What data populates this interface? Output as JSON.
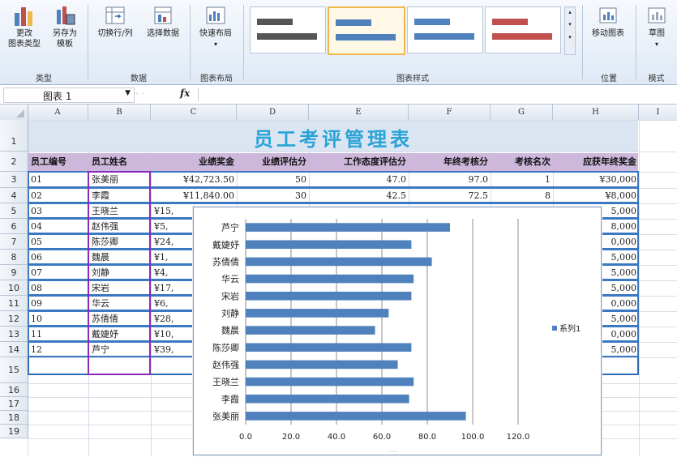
{
  "ribbon": {
    "buttons": [
      {
        "id": "change-type",
        "label1": "更改",
        "label2": "图表类型"
      },
      {
        "id": "save-template",
        "label1": "另存为",
        "label2": "模板"
      },
      {
        "id": "switch-row-col",
        "label1": "切换行/列",
        "label2": ""
      },
      {
        "id": "select-data",
        "label1": "选择数据",
        "label2": ""
      },
      {
        "id": "quick-layout",
        "label1": "快速布局",
        "label2": ""
      },
      {
        "id": "move-chart",
        "label1": "移动图表",
        "label2": ""
      },
      {
        "id": "draft",
        "label1": "草图",
        "label2": ""
      }
    ],
    "groups": {
      "type": "类型",
      "data": "数据",
      "layouts": "图表布局",
      "styles": "图表样式",
      "location": "位置",
      "mode": "模式"
    },
    "colors": {
      "style_dark": "#555555",
      "style_blue": "#4f81bd",
      "style_red": "#c0504d",
      "accent": "#f0b84a"
    }
  },
  "formula_bar": {
    "name_box": "图表 1",
    "fx": "fx"
  },
  "columns": [
    "A",
    "B",
    "C",
    "D",
    "E",
    "F",
    "G",
    "H",
    "I"
  ],
  "rows": [
    "1",
    "2",
    "3",
    "4",
    "5",
    "6",
    "7",
    "8",
    "9",
    "10",
    "11",
    "12",
    "13",
    "14",
    "15",
    "16",
    "17",
    "18",
    "19"
  ],
  "sheet": {
    "title": "员工考评管理表",
    "headers": [
      "员工编号",
      "员工姓名",
      "业绩奖金",
      "业绩评估分",
      "工作态度评估分",
      "年终考核分",
      "考核名次",
      "应获年终奖金"
    ],
    "rows": [
      {
        "id": "01",
        "name": "张美丽",
        "bonus": "¥42,723.50",
        "perf": "50",
        "att": "47.0",
        "final": "97.0",
        "rank": "1",
        "award": "¥30,000"
      },
      {
        "id": "02",
        "name": "李霞",
        "bonus": "¥11,840.00",
        "perf": "30",
        "att": "42.5",
        "final": "72.5",
        "rank": "8",
        "award": "¥8,000"
      },
      {
        "id": "03",
        "name": "王晓兰",
        "bonus": "¥15,",
        "award": "5,000"
      },
      {
        "id": "04",
        "name": "赵伟强",
        "bonus": "¥5,",
        "award": "8,000"
      },
      {
        "id": "05",
        "name": "陈莎卿",
        "bonus": "¥24,",
        "award": "0,000"
      },
      {
        "id": "06",
        "name": "魏晨",
        "bonus": "¥1,",
        "award": "5,000"
      },
      {
        "id": "07",
        "name": "刘静",
        "bonus": "¥4,",
        "award": "5,000"
      },
      {
        "id": "08",
        "name": "宋岩",
        "bonus": "¥17,",
        "award": "5,000"
      },
      {
        "id": "09",
        "name": "华云",
        "bonus": "¥6,",
        "award": "0,000"
      },
      {
        "id": "10",
        "name": "苏倩倩",
        "bonus": "¥28,",
        "award": "5,000"
      },
      {
        "id": "11",
        "name": "戴婕妤",
        "bonus": "¥10,",
        "award": "0,000"
      },
      {
        "id": "12",
        "name": "芦宁",
        "bonus": "¥39,",
        "award": "5,000"
      }
    ]
  },
  "chart_data": {
    "type": "bar",
    "orientation": "horizontal",
    "categories": [
      "芦宁",
      "戴婕妤",
      "苏倩倩",
      "华云",
      "宋岩",
      "刘静",
      "魏晨",
      "陈莎卿",
      "赵伟强",
      "王晓兰",
      "李霞",
      "张美丽"
    ],
    "series": [
      {
        "name": "系列1",
        "values": [
          90,
          73,
          82,
          74,
          73,
          63,
          57,
          73,
          67,
          74,
          72,
          97
        ]
      }
    ],
    "x_ticks": [
      "0.0",
      "20.0",
      "40.0",
      "60.0",
      "80.0",
      "100.0",
      "120.0"
    ],
    "xlim": [
      0,
      120
    ],
    "grid": true,
    "legend": "right",
    "bar_color": "#4f81bd"
  }
}
